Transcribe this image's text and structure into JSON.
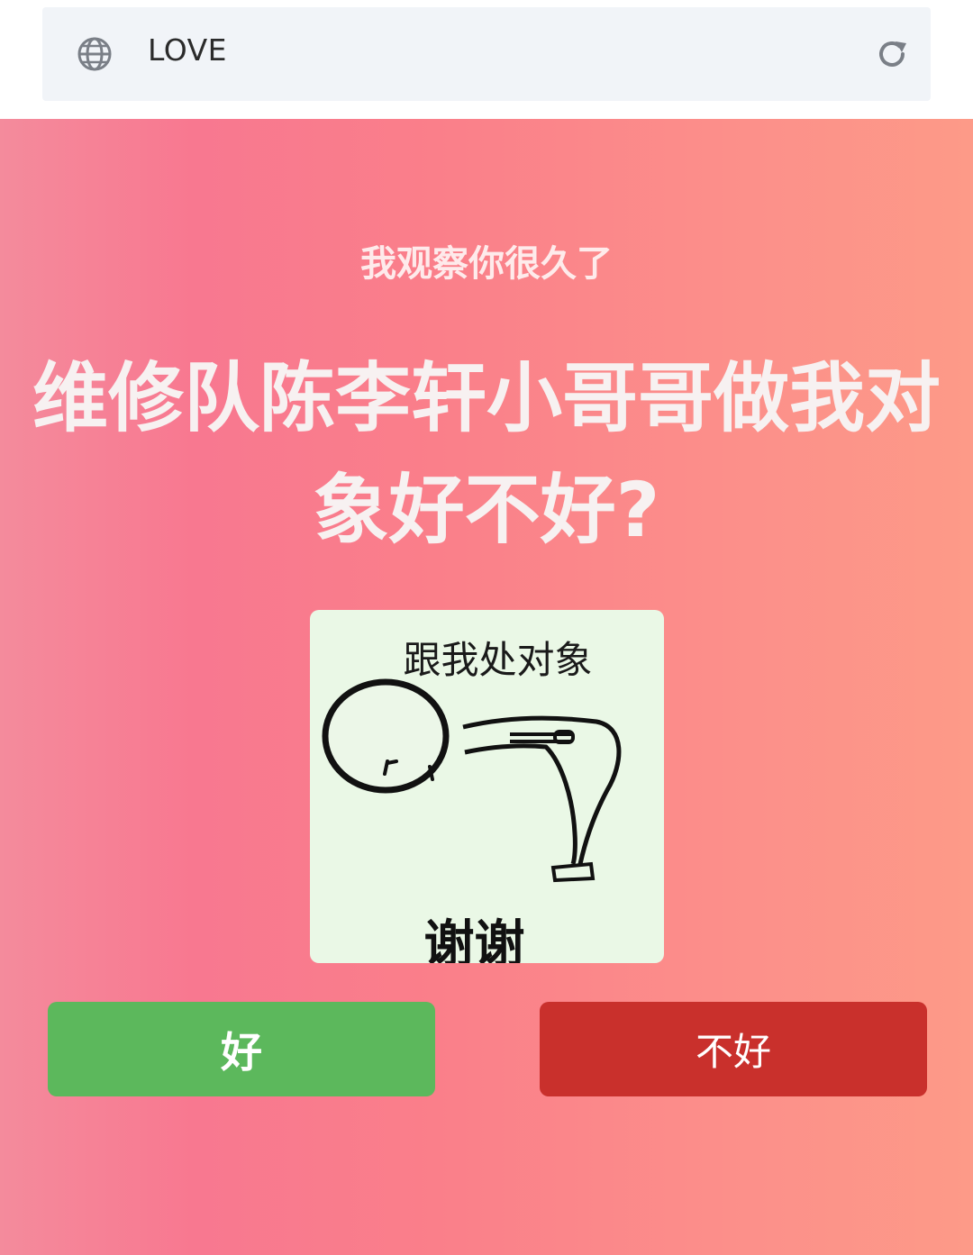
{
  "browser": {
    "title": "LOVE"
  },
  "page": {
    "kicker": "我观察你很久了",
    "question": "维修队陈李轩小哥哥做我对象好不好?",
    "meme": {
      "top_text": "跟我处对象",
      "bottom_text": "谢谢"
    },
    "buttons": {
      "yes_label": "好",
      "no_label": "不好"
    }
  },
  "colors": {
    "yes_button": "#5cb85c",
    "no_button": "#c9302c",
    "address_bar": "#f1f4f8"
  },
  "icons": {
    "left": "globe-icon",
    "right": "reload-icon"
  }
}
